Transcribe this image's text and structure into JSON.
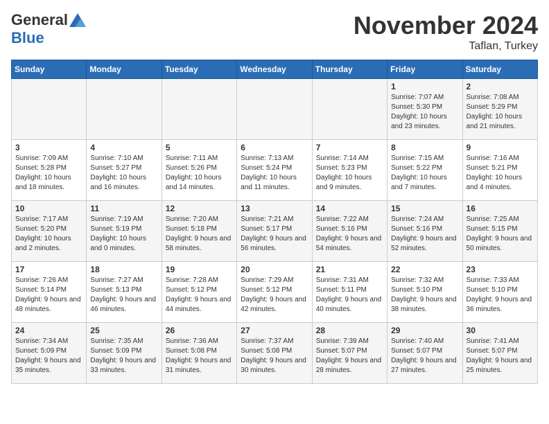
{
  "header": {
    "logo_general": "General",
    "logo_blue": "Blue",
    "month_title": "November 2024",
    "location": "Taflan, Turkey"
  },
  "days_of_week": [
    "Sunday",
    "Monday",
    "Tuesday",
    "Wednesday",
    "Thursday",
    "Friday",
    "Saturday"
  ],
  "weeks": [
    [
      {
        "day": "",
        "info": ""
      },
      {
        "day": "",
        "info": ""
      },
      {
        "day": "",
        "info": ""
      },
      {
        "day": "",
        "info": ""
      },
      {
        "day": "",
        "info": ""
      },
      {
        "day": "1",
        "info": "Sunrise: 7:07 AM\nSunset: 5:30 PM\nDaylight: 10 hours and 23 minutes."
      },
      {
        "day": "2",
        "info": "Sunrise: 7:08 AM\nSunset: 5:29 PM\nDaylight: 10 hours and 21 minutes."
      }
    ],
    [
      {
        "day": "3",
        "info": "Sunrise: 7:09 AM\nSunset: 5:28 PM\nDaylight: 10 hours and 18 minutes."
      },
      {
        "day": "4",
        "info": "Sunrise: 7:10 AM\nSunset: 5:27 PM\nDaylight: 10 hours and 16 minutes."
      },
      {
        "day": "5",
        "info": "Sunrise: 7:11 AM\nSunset: 5:26 PM\nDaylight: 10 hours and 14 minutes."
      },
      {
        "day": "6",
        "info": "Sunrise: 7:13 AM\nSunset: 5:24 PM\nDaylight: 10 hours and 11 minutes."
      },
      {
        "day": "7",
        "info": "Sunrise: 7:14 AM\nSunset: 5:23 PM\nDaylight: 10 hours and 9 minutes."
      },
      {
        "day": "8",
        "info": "Sunrise: 7:15 AM\nSunset: 5:22 PM\nDaylight: 10 hours and 7 minutes."
      },
      {
        "day": "9",
        "info": "Sunrise: 7:16 AM\nSunset: 5:21 PM\nDaylight: 10 hours and 4 minutes."
      }
    ],
    [
      {
        "day": "10",
        "info": "Sunrise: 7:17 AM\nSunset: 5:20 PM\nDaylight: 10 hours and 2 minutes."
      },
      {
        "day": "11",
        "info": "Sunrise: 7:19 AM\nSunset: 5:19 PM\nDaylight: 10 hours and 0 minutes."
      },
      {
        "day": "12",
        "info": "Sunrise: 7:20 AM\nSunset: 5:18 PM\nDaylight: 9 hours and 58 minutes."
      },
      {
        "day": "13",
        "info": "Sunrise: 7:21 AM\nSunset: 5:17 PM\nDaylight: 9 hours and 56 minutes."
      },
      {
        "day": "14",
        "info": "Sunrise: 7:22 AM\nSunset: 5:16 PM\nDaylight: 9 hours and 54 minutes."
      },
      {
        "day": "15",
        "info": "Sunrise: 7:24 AM\nSunset: 5:16 PM\nDaylight: 9 hours and 52 minutes."
      },
      {
        "day": "16",
        "info": "Sunrise: 7:25 AM\nSunset: 5:15 PM\nDaylight: 9 hours and 50 minutes."
      }
    ],
    [
      {
        "day": "17",
        "info": "Sunrise: 7:26 AM\nSunset: 5:14 PM\nDaylight: 9 hours and 48 minutes."
      },
      {
        "day": "18",
        "info": "Sunrise: 7:27 AM\nSunset: 5:13 PM\nDaylight: 9 hours and 46 minutes."
      },
      {
        "day": "19",
        "info": "Sunrise: 7:28 AM\nSunset: 5:12 PM\nDaylight: 9 hours and 44 minutes."
      },
      {
        "day": "20",
        "info": "Sunrise: 7:29 AM\nSunset: 5:12 PM\nDaylight: 9 hours and 42 minutes."
      },
      {
        "day": "21",
        "info": "Sunrise: 7:31 AM\nSunset: 5:11 PM\nDaylight: 9 hours and 40 minutes."
      },
      {
        "day": "22",
        "info": "Sunrise: 7:32 AM\nSunset: 5:10 PM\nDaylight: 9 hours and 38 minutes."
      },
      {
        "day": "23",
        "info": "Sunrise: 7:33 AM\nSunset: 5:10 PM\nDaylight: 9 hours and 36 minutes."
      }
    ],
    [
      {
        "day": "24",
        "info": "Sunrise: 7:34 AM\nSunset: 5:09 PM\nDaylight: 9 hours and 35 minutes."
      },
      {
        "day": "25",
        "info": "Sunrise: 7:35 AM\nSunset: 5:09 PM\nDaylight: 9 hours and 33 minutes."
      },
      {
        "day": "26",
        "info": "Sunrise: 7:36 AM\nSunset: 5:08 PM\nDaylight: 9 hours and 31 minutes."
      },
      {
        "day": "27",
        "info": "Sunrise: 7:37 AM\nSunset: 5:08 PM\nDaylight: 9 hours and 30 minutes."
      },
      {
        "day": "28",
        "info": "Sunrise: 7:39 AM\nSunset: 5:07 PM\nDaylight: 9 hours and 28 minutes."
      },
      {
        "day": "29",
        "info": "Sunrise: 7:40 AM\nSunset: 5:07 PM\nDaylight: 9 hours and 27 minutes."
      },
      {
        "day": "30",
        "info": "Sunrise: 7:41 AM\nSunset: 5:07 PM\nDaylight: 9 hours and 25 minutes."
      }
    ]
  ]
}
